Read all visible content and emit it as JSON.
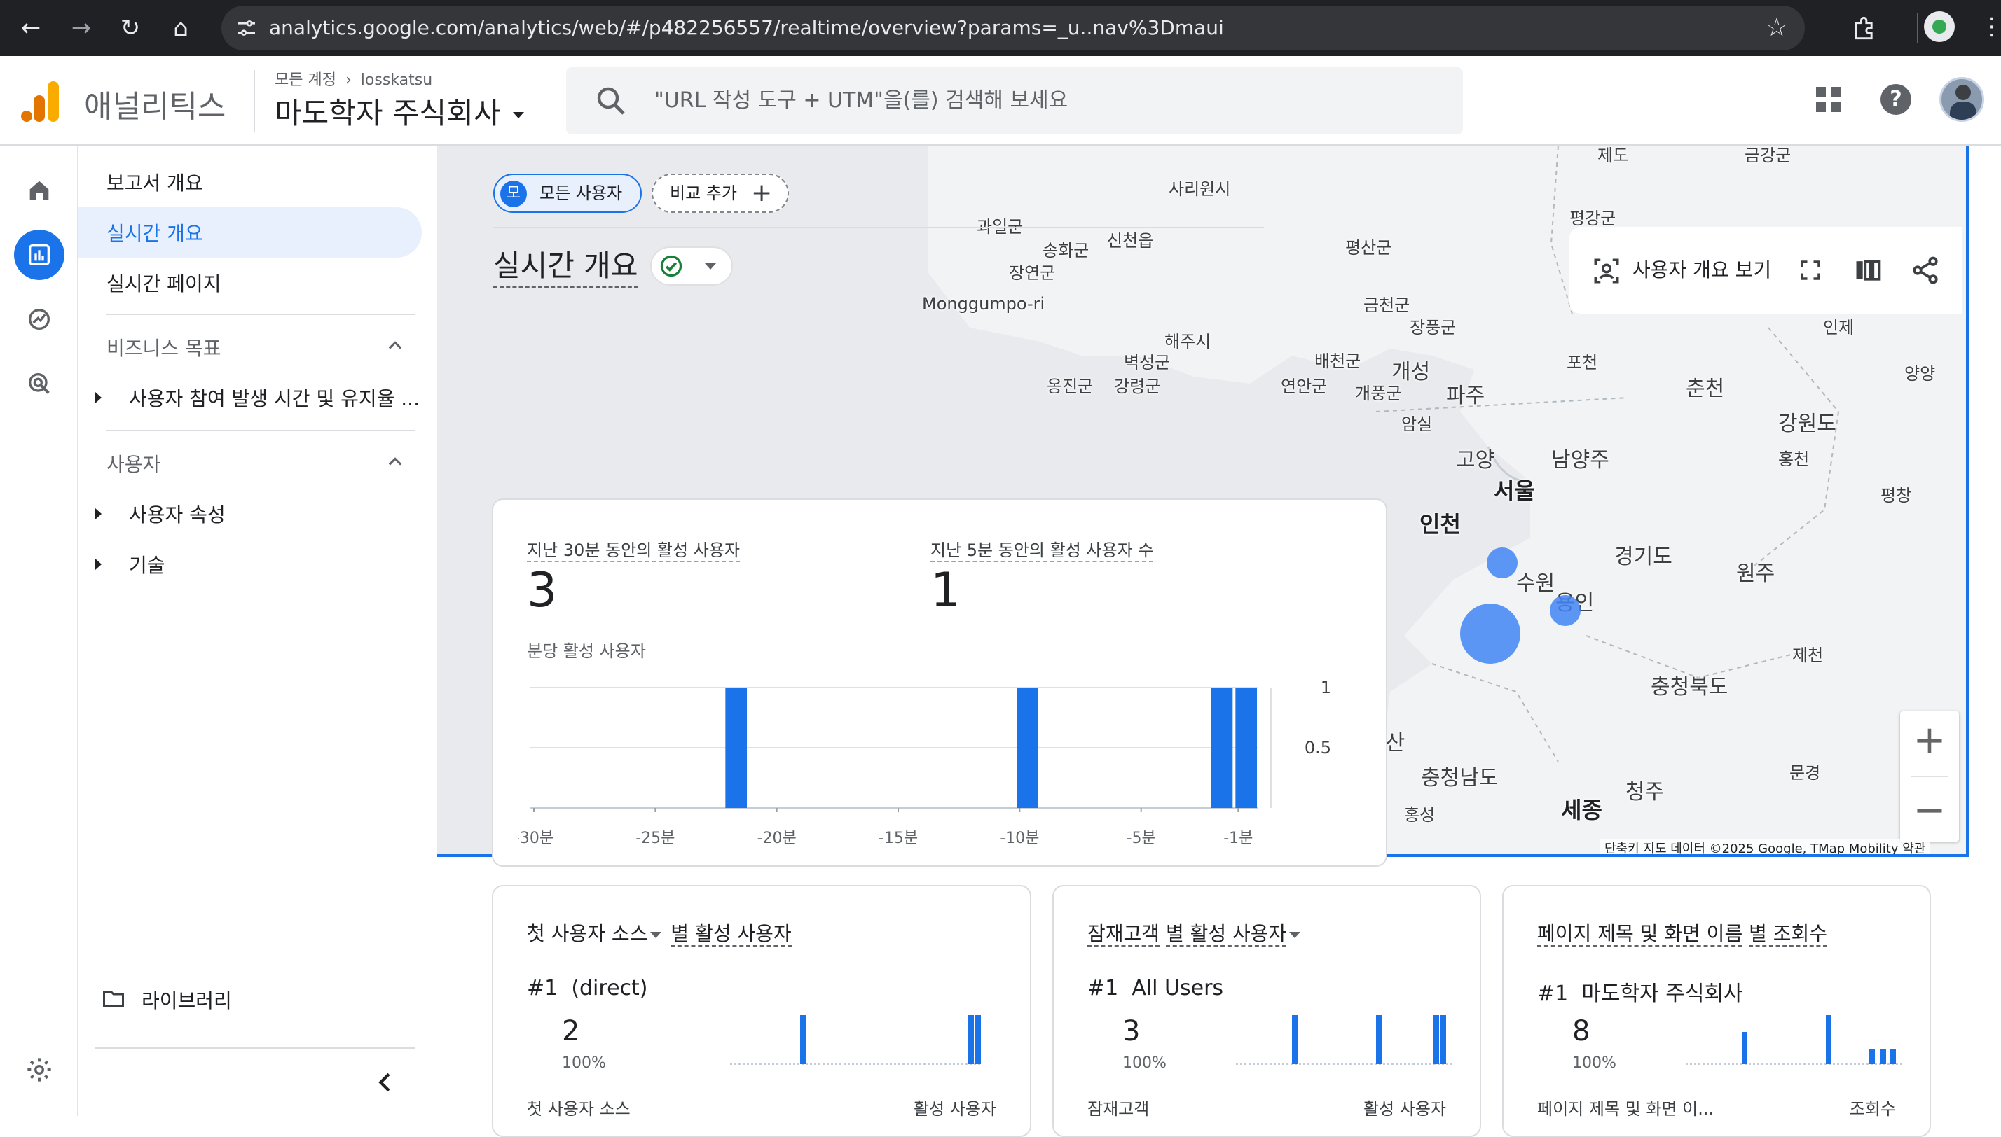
{
  "browser": {
    "url": "analytics.google.com/analytics/web/#/p482256557/realtime/overview?params=_u..nav%3Dmaui"
  },
  "header": {
    "app_name": "애널리틱스",
    "breadcrumb_root": "모든 계정",
    "breadcrumb_account": "losskatsu",
    "property_name": "마도학자 주식회사",
    "search_placeholder": "\"URL 작성 도구 + UTM\"을(를) 검색해 보세요"
  },
  "nav": {
    "report_overview": "보고서 개요",
    "realtime_overview": "실시간 개요",
    "realtime_pages": "실시간 페이지",
    "business_goals": "비즈니스 목표",
    "engagement_item": "사용자 참여 발생 시간 및 유지율 ...",
    "users_section": "사용자",
    "user_attributes": "사용자 속성",
    "tech": "기술",
    "library": "라이브러리"
  },
  "toolbar": {
    "all_users_badge": "모",
    "all_users": "모든 사용자",
    "add_comparison": "비교 추가",
    "page_title": "실시간 개요",
    "view_user_overview": "사용자 개요 보기"
  },
  "map": {
    "labels": [
      "제도",
      "금강군",
      "사리원시",
      "과일군",
      "송화군",
      "신천읍",
      "평강군",
      "장연군",
      "평산군",
      "Monggumpo-ri",
      "금천군",
      "장풍군",
      "해주시",
      "인제",
      "벽성군",
      "배천군",
      "포천",
      "양양",
      "옹진군",
      "강령군",
      "연안군",
      "개성",
      "개풍군",
      "파주",
      "춘천",
      "암실",
      "강원도",
      "고양",
      "남양주",
      "홍천",
      "서울",
      "평창",
      "인천",
      "경기도",
      "수원",
      "원주",
      "용인",
      "제천",
      "충청북도",
      "서산",
      "충청남도",
      "문경",
      "청주",
      "세종",
      "홍성"
    ],
    "attribution": "단축키   지도 데이터 ©2025 Google, TMap Mobility   약관"
  },
  "realtime": {
    "metric1_label": "지난 30분 동안의 활성 사용자",
    "metric1_value": "3",
    "metric2_label": "지난 5분 동안의 활성 사용자 수",
    "metric2_value": "1",
    "chart_label": "분당 활성 사용자"
  },
  "chart_data": {
    "type": "bar",
    "title": "분당 활성 사용자",
    "x_ticks": [
      "-30분",
      "-25분",
      "-20분",
      "-15분",
      "-10분",
      "-5분",
      "-1분"
    ],
    "y_ticks": [
      "1",
      "0.5"
    ],
    "ylim": [
      0,
      1
    ],
    "bars": [
      {
        "minute": -22,
        "value": 1
      },
      {
        "minute": -10,
        "value": 1
      },
      {
        "minute": -2,
        "value": 1
      },
      {
        "minute": -1,
        "value": 1
      }
    ],
    "color": "#1a73e8"
  },
  "cards": [
    {
      "title_pre": "첫 사용자 소스",
      "title_post": "별 활성 사용자",
      "rank": "#1",
      "top_name": "(direct)",
      "top_value": "2",
      "top_pct": "100%",
      "col_left": "첫 사용자 소스",
      "col_right": "활성 사용자"
    },
    {
      "title_pre": "잠재고객",
      "title_post": "별 활성 사용자",
      "rank": "#1",
      "top_name": "All Users",
      "top_value": "3",
      "top_pct": "100%",
      "col_left": "잠재고객",
      "col_right": "활성 사용자"
    },
    {
      "title_pre": "페이지 제목 및 화면 이름",
      "title_post": "별 조회수",
      "rank": "#1",
      "top_name": "마도학자 주식회사",
      "top_value": "8",
      "top_pct": "100%",
      "col_left": "페이지 제목 및 화면 이...",
      "col_right": "조회수"
    }
  ]
}
